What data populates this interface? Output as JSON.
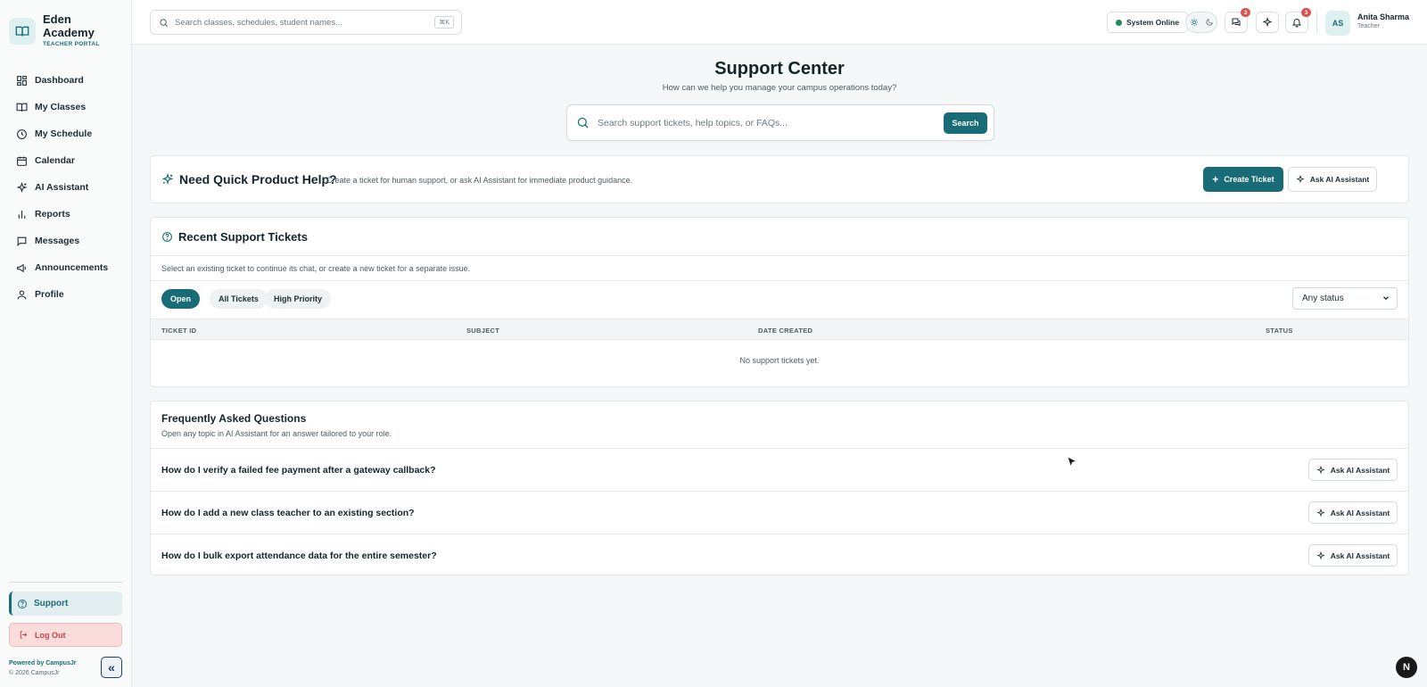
{
  "sidebar": {
    "brand_name": "Eden Academy",
    "brand_sub": "TEACHER PORTAL",
    "items": [
      {
        "label": "Dashboard",
        "icon": "grid-icon"
      },
      {
        "label": "My Classes",
        "icon": "book-icon"
      },
      {
        "label": "My Schedule",
        "icon": "clock-icon"
      },
      {
        "label": "Calendar",
        "icon": "calendar-icon"
      },
      {
        "label": "AI Assistant",
        "icon": "sparkles-icon"
      },
      {
        "label": "Reports",
        "icon": "bar-chart-icon"
      },
      {
        "label": "Messages",
        "icon": "message-icon"
      },
      {
        "label": "Announcements",
        "icon": "megaphone-icon"
      },
      {
        "label": "Profile",
        "icon": "user-icon"
      }
    ],
    "support_label": "Support",
    "logout_label": "Log Out",
    "powered_by": "Powered by CampusJr",
    "copyright": "© 2026 CampusJr"
  },
  "topbar": {
    "search_placeholder": "Search classes, schedules, student names...",
    "shortcut": "⌘K",
    "system_status": "System Online",
    "messages_badge": "3",
    "notifications_badge": "3",
    "user_initials": "AS",
    "user_name": "Anita Sharma",
    "user_role": "Teacher"
  },
  "page": {
    "title": "Support Center",
    "subtitle": "How can we help you manage your campus operations today?",
    "search_placeholder": "Search support tickets, help topics, or FAQs...",
    "search_button": "Search"
  },
  "quick_help": {
    "title": "Need Quick Product Help?",
    "description": "Create a ticket for human support, or ask AI Assistant for immediate product guidance.",
    "create_ticket": "Create Ticket",
    "ask_ai": "Ask AI Assistant"
  },
  "tickets": {
    "title": "Recent Support Tickets",
    "description": "Select an existing ticket to continue its chat, or create a new ticket for a separate issue.",
    "filters": [
      "Open",
      "All Tickets",
      "High Priority"
    ],
    "active_filter": "Open",
    "status_select": "Any status",
    "columns": [
      "TICKET ID",
      "SUBJECT",
      "DATE CREATED",
      "STATUS"
    ],
    "empty_message": "No support tickets yet."
  },
  "faq": {
    "title": "Frequently Asked Questions",
    "description": "Open any topic in AI Assistant for an answer tailored to your role.",
    "questions": [
      "How do I verify a failed fee payment after a gateway callback?",
      "How do I add a new class teacher to an existing section?",
      "How do I bulk export attendance data for the entire semester?"
    ],
    "ask_label": "Ask AI Assistant"
  },
  "colors": {
    "accent": "#176c77",
    "danger": "#d9534f",
    "online": "#1f8a5a"
  }
}
